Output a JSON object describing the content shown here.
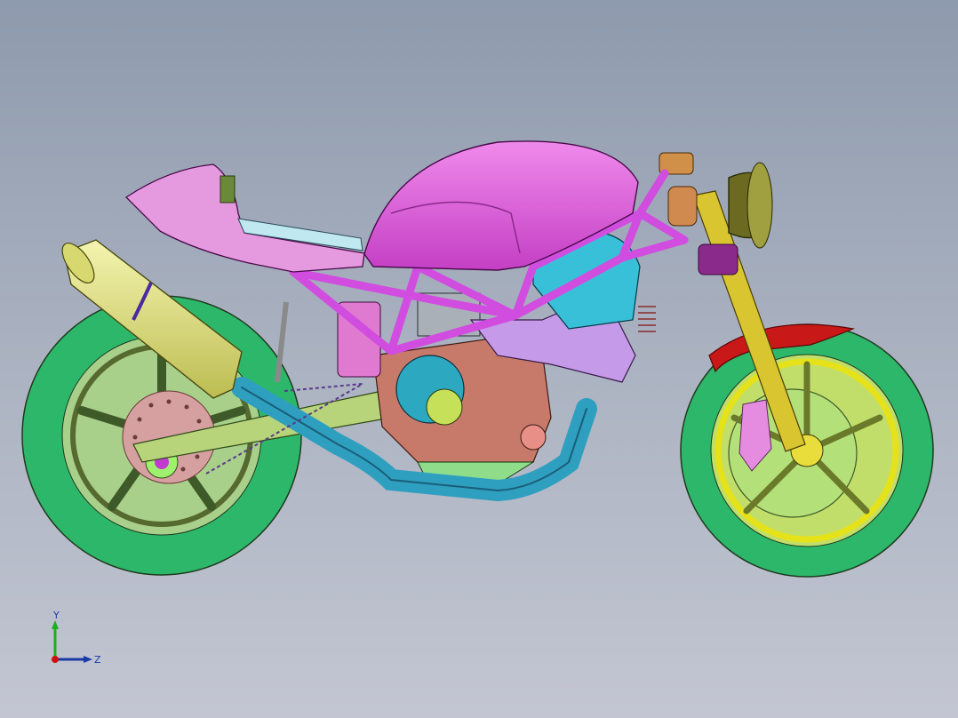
{
  "viewport": {
    "background_top": "#8e9aad",
    "background_bottom": "#c3c6d2"
  },
  "model": {
    "subject": "motorcycle-assembly",
    "colors": {
      "tire": "#3fd07a",
      "frame": "#d14de0",
      "tank": "#e060d8",
      "seat": "#e59ae0",
      "exhaust": "#2f9fc0",
      "muffler": "#e6e68a",
      "fork": "#d8c530",
      "fender": "#c81818",
      "engine": "#c87a6a",
      "headlight": "#6b6a20",
      "swingarm": "#b7d47a",
      "disc": "#d6a0a0"
    }
  },
  "triad": {
    "y_label": "Y",
    "z_label": "Z",
    "y_color": "#1fae1f",
    "z_color": "#1b3aa8",
    "x_color": "#d01010"
  }
}
